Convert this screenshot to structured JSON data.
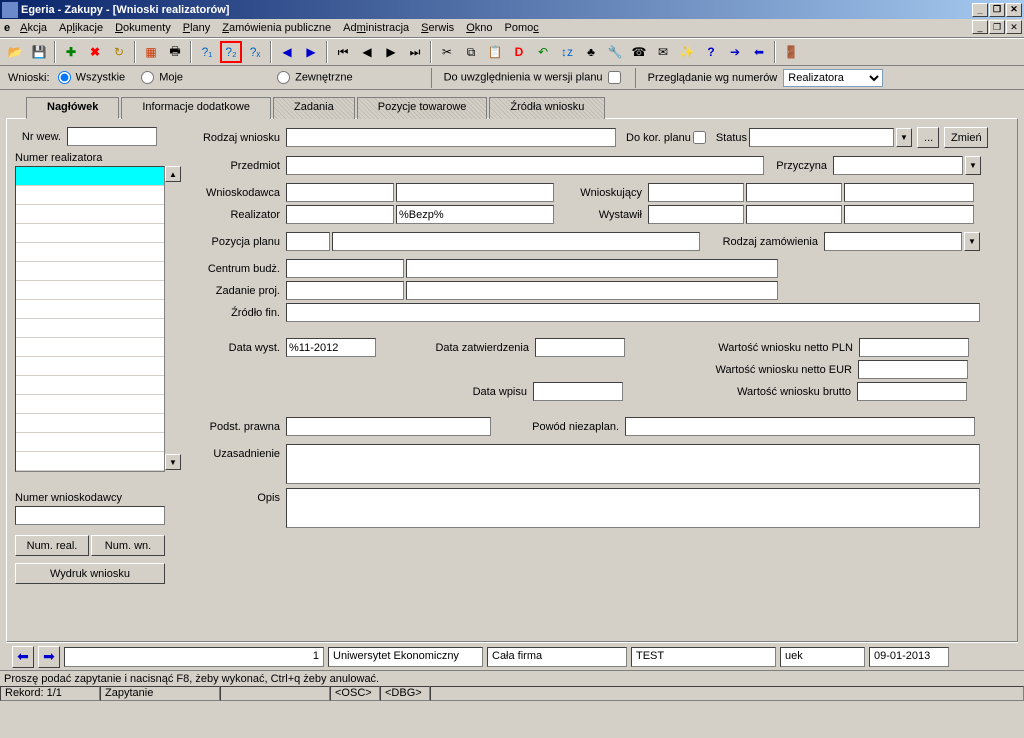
{
  "window": {
    "title": "Egeria - Zakupy - [Wnioski realizatorów]"
  },
  "menu": {
    "akcja": "Akcja",
    "aplikacje": "Aplikacje",
    "dokumenty": "Dokumenty",
    "plany": "Plany",
    "zamowienia": "Zamówienia publiczne",
    "administracja": "Administracja",
    "serwis": "Serwis",
    "okno": "Okno",
    "pomoc": "Pomoc"
  },
  "filter": {
    "wnioski_label": "Wnioski:",
    "wszystkie": "Wszystkie",
    "moje": "Moje",
    "zewnetrzne": "Zewnętrzne",
    "do_uwzg": "Do uwzględnienia w wersji planu",
    "przegladanie": "Przeglądanie wg numerów",
    "przegladanie_value": "Realizatora"
  },
  "tabs": {
    "naglowek": "Nagłówek",
    "info_dodatkowe": "Informacje dodatkowe",
    "zadania": "Zadania",
    "pozycje": "Pozycje towarowe",
    "zrodla": "Źródła wniosku"
  },
  "left": {
    "nr_wew": "Nr wew.",
    "numer_realizatora": "Numer realizatora",
    "numer_wnioskodawcy": "Numer wnioskodawcy",
    "num_real_btn": "Num. real.",
    "num_wn_btn": "Num. wn.",
    "wydruk_btn": "Wydruk wniosku"
  },
  "form": {
    "rodzaj_wniosku": "Rodzaj wniosku",
    "do_kor_planu": "Do kor. planu",
    "status": "Status",
    "ellipsis": "...",
    "zmien": "Zmień",
    "przedmiot": "Przedmiot",
    "przyczyna": "Przyczyna",
    "wnioskodawca": "Wnioskodawca",
    "wnioskujacy": "Wnioskujący",
    "realizator": "Realizator",
    "realizator_value": "%Bezp%",
    "wystawil": "Wystawił",
    "pozycja_planu": "Pozycja planu",
    "rodzaj_zamowienia": "Rodzaj zamówienia",
    "centrum_budz": "Centrum budż.",
    "zadanie_proj": "Zadanie proj.",
    "zrodlo_fin": "Źródło fin.",
    "data_wyst": "Data wyst.",
    "data_wyst_value": "%11-2012",
    "data_zatw": "Data zatwierdzenia",
    "wartosc_netto_pln": "Wartość wniosku netto PLN",
    "wartosc_netto_eur": "Wartość wniosku netto EUR",
    "data_wpisu": "Data wpisu",
    "wartosc_brutto": "Wartość wniosku brutto",
    "podst_prawna": "Podst. prawna",
    "powod_niezaplan": "Powód niezaplan.",
    "uzasadnienie": "Uzasadnienie",
    "opis": "Opis"
  },
  "bottom": {
    "seq": "1",
    "f1": "Uniwersytet Ekonomiczny",
    "f2": "Cała firma",
    "f3": "TEST",
    "f4": "uek",
    "f5": "09-01-2013"
  },
  "status": {
    "msg": "Proszę podać zapytanie i nacisnąć F8, żeby wykonać, Ctrl+q  żeby anulować.",
    "rekord": "Rekord: 1/1",
    "zapytanie": "Zapytanie",
    "osc": "<OSC>",
    "dbg": "<DBG>"
  }
}
